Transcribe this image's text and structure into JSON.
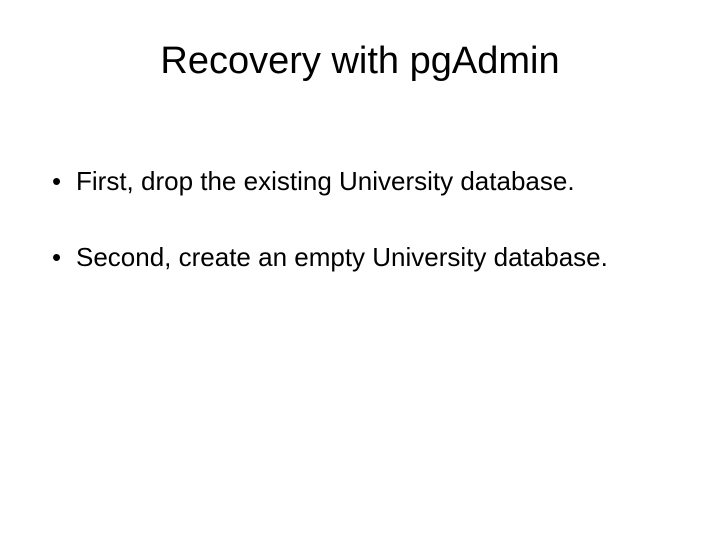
{
  "slide": {
    "title": "Recovery with pgAdmin",
    "bullets": [
      "First, drop the existing University database.",
      "Second, create an empty University database."
    ]
  }
}
